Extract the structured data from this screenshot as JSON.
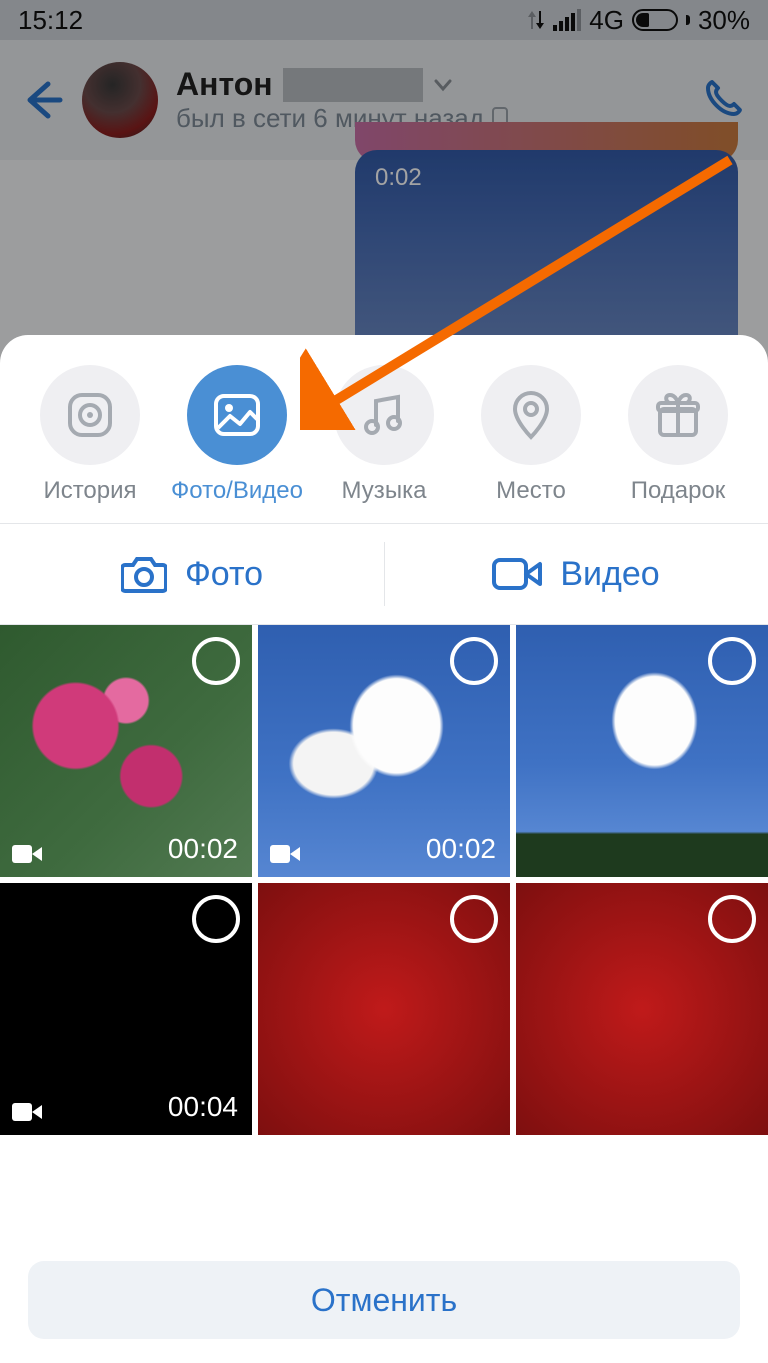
{
  "status": {
    "time": "15:12",
    "network": "4G",
    "battery_pct": "30%"
  },
  "chat": {
    "name": "Антон",
    "status": "был в сети 6 минут назад",
    "preview_duration": "0:02"
  },
  "attach": {
    "items": [
      {
        "label": "История"
      },
      {
        "label": "Фото/Видео"
      },
      {
        "label": "Музыка"
      },
      {
        "label": "Место"
      },
      {
        "label": "Подарок"
      }
    ]
  },
  "subtabs": {
    "photo": "Фото",
    "video": "Видео"
  },
  "gallery": {
    "items": [
      {
        "duration": "00:02",
        "is_video": true
      },
      {
        "duration": "00:02",
        "is_video": true
      },
      {
        "is_video": false
      },
      {
        "duration": "00:04",
        "is_video": true
      },
      {
        "is_video": false
      },
      {
        "is_video": false
      }
    ]
  },
  "cancel_label": "Отменить",
  "colors": {
    "accent": "#2a72c9",
    "active_pill": "#4a8fd4",
    "annotation": "#f56a00"
  }
}
